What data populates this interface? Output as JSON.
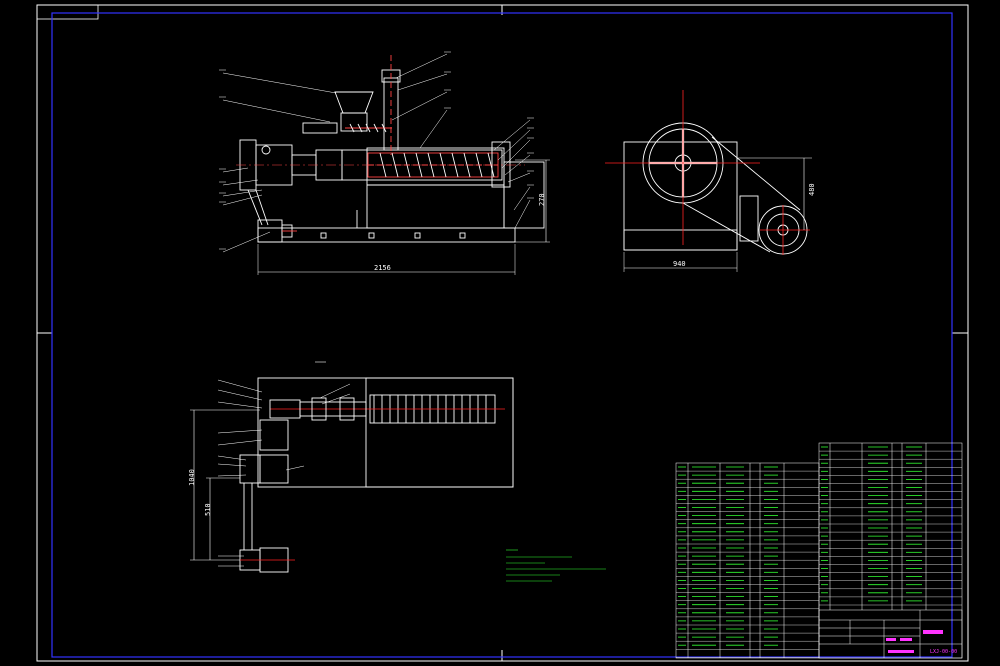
{
  "dimensions": {
    "front_length": "2156",
    "front_height": "270",
    "side_width": "940",
    "side_height": "480",
    "plan_overall": "1040",
    "plan_offset": "510"
  },
  "colors": {
    "background": "#000000",
    "line": "#ffffff",
    "center": "#ff2222",
    "dimension": "#ffffff",
    "table_line": "#ffffff",
    "table_text_green": "#33ff33",
    "table_text_magenta": "#ff33ff",
    "frame": "#3333ff"
  },
  "title_block": {
    "drawing_number": "LXJ-00-00"
  }
}
